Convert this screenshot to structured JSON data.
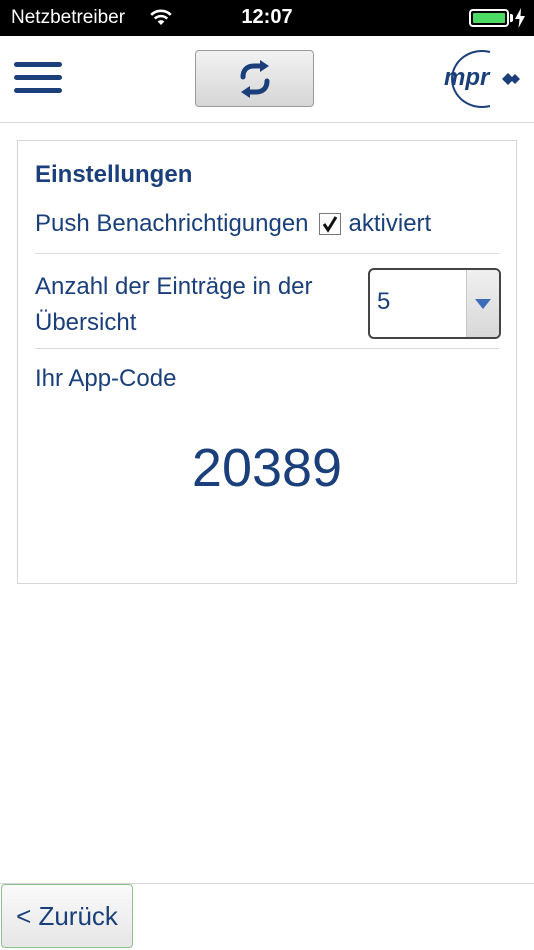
{
  "status_bar": {
    "carrier": "Netzbetreiber",
    "time": "12:07",
    "battery_level": 1.0,
    "charging": true,
    "icons": [
      "wifi-icon",
      "battery-icon",
      "charging-bolt-icon"
    ]
  },
  "header": {
    "menu_icon": "hamburger-menu-icon",
    "refresh_icon": "refresh-icon",
    "logo_text": "mpr",
    "colors": {
      "primary": "#1a3f7a",
      "checkbox_green": "#8fbf8f"
    }
  },
  "settings": {
    "title": "Einstellungen",
    "push_label": "Push Benachrichtigungen",
    "push_checked": true,
    "push_state_label": "aktiviert",
    "entries_label": "Anzahl der Einträge in der Übersicht",
    "entries_value": "5",
    "app_code_label": "Ihr App-Code",
    "app_code_value": "20389"
  },
  "footer": {
    "back_label": "< Zurück"
  }
}
